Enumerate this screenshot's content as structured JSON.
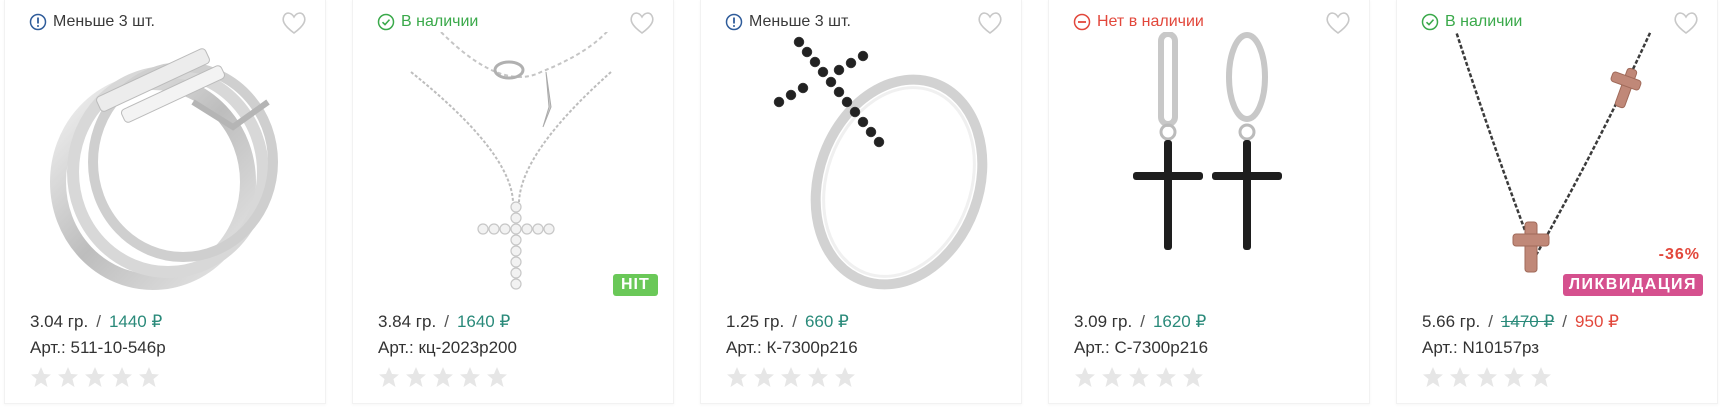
{
  "products": [
    {
      "status": {
        "type": "few",
        "label": "Меньше 3 шт."
      },
      "weight": "3.04 гр.",
      "separator": "/",
      "price": "1440 ₽",
      "article": "Арт.: 511-10-546р",
      "rating": 0,
      "image": "silver-multi-band-ring-with-cubic-zirconia-stripes"
    },
    {
      "status": {
        "type": "in",
        "label": "В наличии"
      },
      "weight": "3.84 гр.",
      "separator": "/",
      "price": "1640 ₽",
      "article": "Арт.: кц-2023р200",
      "rating": 0,
      "badge": "HIT",
      "image": "silver-chain-necklace-with-cz-cross-pendant"
    },
    {
      "status": {
        "type": "few",
        "label": "Меньше 3 шт."
      },
      "weight": "1.25 гр.",
      "separator": "/",
      "price": "660 ₽",
      "article": "Арт.: К-7300р216",
      "rating": 0,
      "image": "silver-ring-with-black-stone-sideways-cross"
    },
    {
      "status": {
        "type": "out",
        "label": "Нет в наличии"
      },
      "weight": "3.09 гр.",
      "separator": "/",
      "price": "1620 ₽",
      "article": "Арт.: С-7300р216",
      "rating": 0,
      "image": "silver-hoop-earrings-with-black-stone-cross-drops"
    },
    {
      "status": {
        "type": "in",
        "label": "В наличии"
      },
      "weight": "5.66 гр.",
      "separator": "/",
      "old_price": "1470 ₽",
      "separator2": "/",
      "price": "950 ₽",
      "article": "Арт.: N10157рз",
      "rating": 0,
      "discount": "-36%",
      "badge": "ЛИКВИДАЦИЯ",
      "image": "dark-chain-necklace-with-rose-gold-crosses"
    }
  ],
  "colors": {
    "accent_price": "#2a8a7a",
    "in_stock": "#3aa94a",
    "out_of_stock": "#e2473b",
    "hit_badge": "#6ac858",
    "liquidation_badge": "#d5508e",
    "star_empty": "#e6e6e6"
  }
}
